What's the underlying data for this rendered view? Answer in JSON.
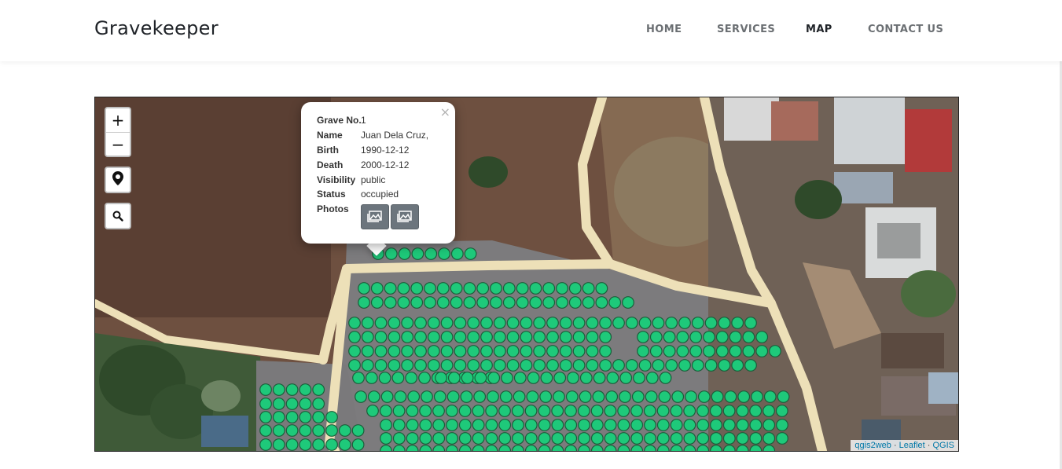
{
  "brand": "Gravekeeper",
  "nav": {
    "items": [
      "HOME",
      "SERVICES",
      "MAP",
      "CONTACT US"
    ],
    "active": "MAP"
  },
  "map_controls": {
    "zoom_in": "+",
    "zoom_out": "−",
    "locate_icon": "map-marker-icon",
    "search_icon": "search-icon"
  },
  "popup": {
    "close": "×",
    "fields": [
      {
        "key": "Grave No.",
        "value": "1"
      },
      {
        "key": "Name",
        "value": "Juan Dela Cruz,"
      },
      {
        "key": "Birth",
        "value": "1990-12-12"
      },
      {
        "key": "Death",
        "value": "2000-12-12"
      },
      {
        "key": "Visibility",
        "value": "public"
      },
      {
        "key": "Status",
        "value": "occupied"
      }
    ],
    "photos_label": "Photos",
    "photo_icon": "image-icon"
  },
  "attribution": {
    "parts": [
      "qgis2web",
      "Leaflet",
      "QGIS"
    ],
    "separator": " · "
  },
  "colors": {
    "grave_fill": "#1ec97a",
    "grave_stroke": "#1b5e3a",
    "road": "#ede0b8",
    "ground": "#6f5140",
    "popup_button": "#6c757d"
  }
}
